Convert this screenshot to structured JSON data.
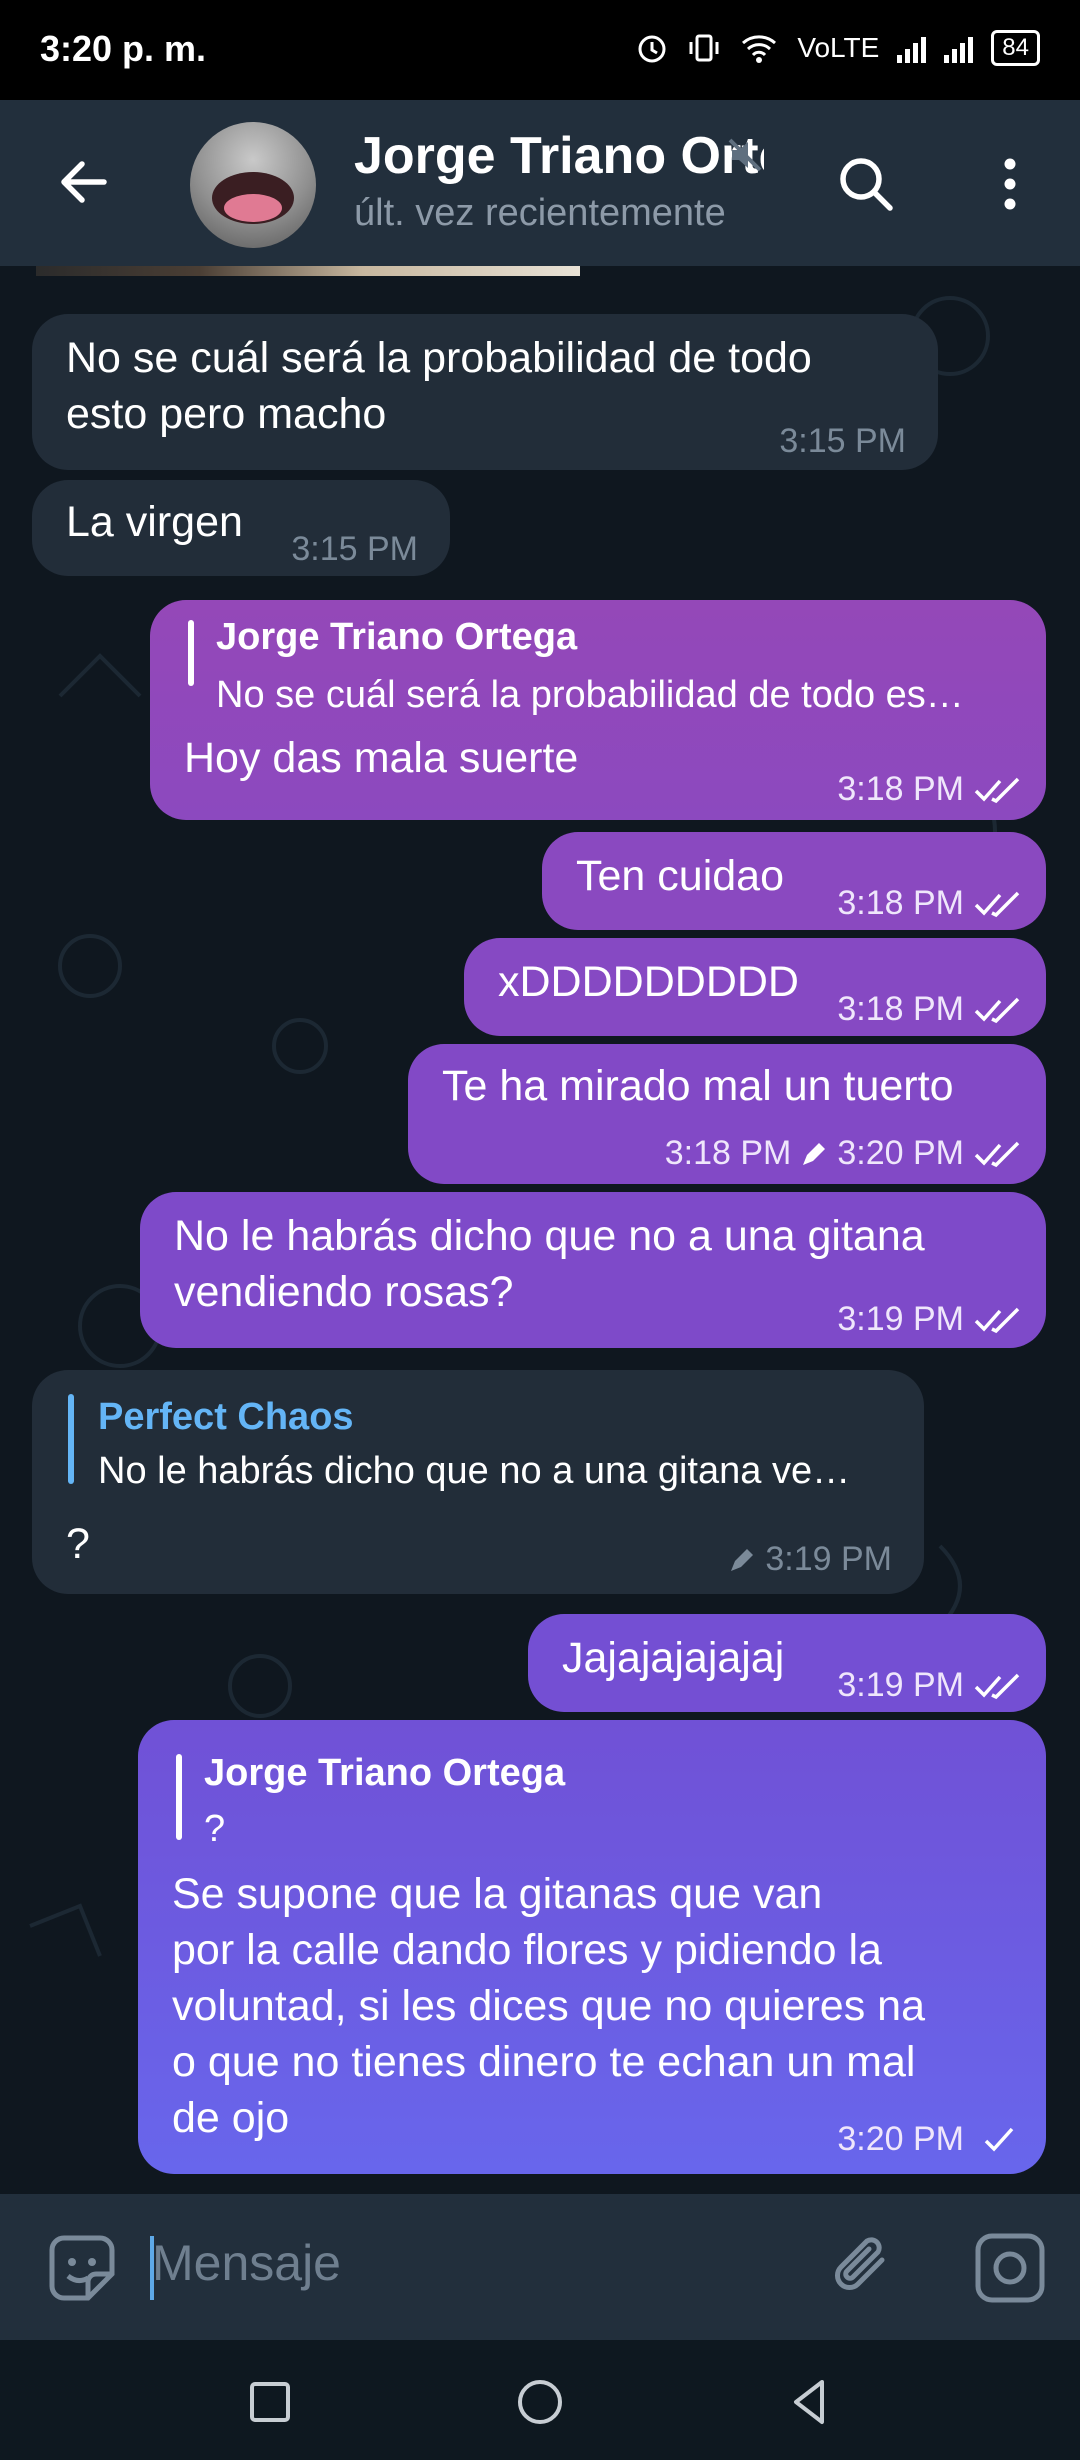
{
  "status_bar": {
    "time": "3:20 p. m.",
    "network": "VoLTE",
    "battery": "84"
  },
  "header": {
    "name": "Jorge Triano Ortega",
    "subtitle": "últ. vez recientemente"
  },
  "messages": [
    {
      "dir": "in",
      "lines": [
        "No se cuál será la probabilidad de todo",
        "esto pero macho"
      ],
      "time": "3:15 PM"
    },
    {
      "dir": "in",
      "lines": [
        "La virgen"
      ],
      "time": "3:15 PM"
    },
    {
      "dir": "out",
      "reply_name": "Jorge Triano Ortega",
      "reply_text": "No se cuál será la probabilidad de todo es…",
      "lines": [
        "Hoy das mala suerte"
      ],
      "time": "3:18 PM",
      "status": "read"
    },
    {
      "dir": "out",
      "lines": [
        "Ten cuidao"
      ],
      "time": "3:18 PM",
      "status": "read"
    },
    {
      "dir": "out",
      "lines": [
        "xDDDDDDDDD"
      ],
      "time": "3:18 PM",
      "status": "read"
    },
    {
      "dir": "out",
      "lines": [
        "Te ha mirado mal un tuerto"
      ],
      "time": "3:18 PM",
      "edited_time": "3:20 PM",
      "status": "read"
    },
    {
      "dir": "out",
      "lines": [
        "No le habrás dicho que no a una gitana",
        "vendiendo rosas?"
      ],
      "time": "3:19 PM",
      "status": "read"
    },
    {
      "dir": "in",
      "reply_name": "Perfect Chaos",
      "reply_text": "No le habrás dicho que no a una gitana ve…",
      "lines": [
        "?"
      ],
      "time": "3:19 PM",
      "edited": true
    },
    {
      "dir": "out",
      "lines": [
        "Jajajajajajaj"
      ],
      "time": "3:19 PM",
      "status": "read"
    },
    {
      "dir": "out",
      "reply_name": "Jorge Triano Ortega",
      "reply_text": "?",
      "lines": [
        "Se supone que la gitanas que van",
        "por la calle dando flores y pidiendo la",
        "voluntad, si les dices que no quieres na",
        "o que no tienes dinero te echan un mal",
        "de ojo"
      ],
      "time": "3:20 PM",
      "status": "sent"
    }
  ],
  "composer": {
    "placeholder": "Mensaje"
  },
  "colors": {
    "outgoing": "#8148c6",
    "incoming": "#222d39",
    "reply_accent_in": "#64b5f6",
    "header": "#222f3c"
  }
}
